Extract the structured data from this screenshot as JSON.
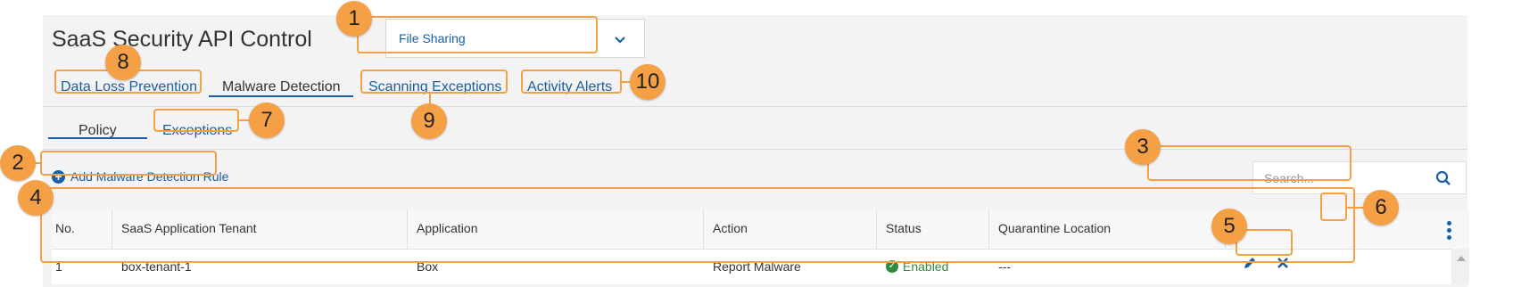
{
  "app": {
    "title": "SaaS Security API Control"
  },
  "dropdown": {
    "selected": "File Sharing",
    "icon": "chevron-down-icon"
  },
  "tabs": [
    {
      "label": "Data Loss Prevention",
      "active": false
    },
    {
      "label": "Malware Detection",
      "active": true
    },
    {
      "label": "Scanning Exceptions",
      "active": false
    },
    {
      "label": "Activity Alerts",
      "active": false
    }
  ],
  "subtabs": [
    {
      "label": "Policy",
      "active": true
    },
    {
      "label": "Exceptions",
      "active": false
    }
  ],
  "add_rule": {
    "label": "Add Malware Detection Rule",
    "icon": "plus-circle-icon"
  },
  "search": {
    "placeholder": "Search...",
    "icon": "search-icon"
  },
  "table": {
    "columns": [
      "No.",
      "SaaS Application Tenant",
      "Application",
      "Action",
      "Status",
      "Quarantine Location"
    ],
    "rows": [
      {
        "no": "1",
        "tenant": "box-tenant-1",
        "application": "Box",
        "action": "Report Malware",
        "status": "Enabled",
        "quarantine": "---"
      }
    ]
  },
  "callouts": [
    "1",
    "2",
    "3",
    "4",
    "5",
    "6",
    "7",
    "8",
    "9",
    "10"
  ],
  "colors": {
    "accent": "#1a5fa3",
    "callout": "#f5a044",
    "enabled": "#2e8b3e"
  }
}
